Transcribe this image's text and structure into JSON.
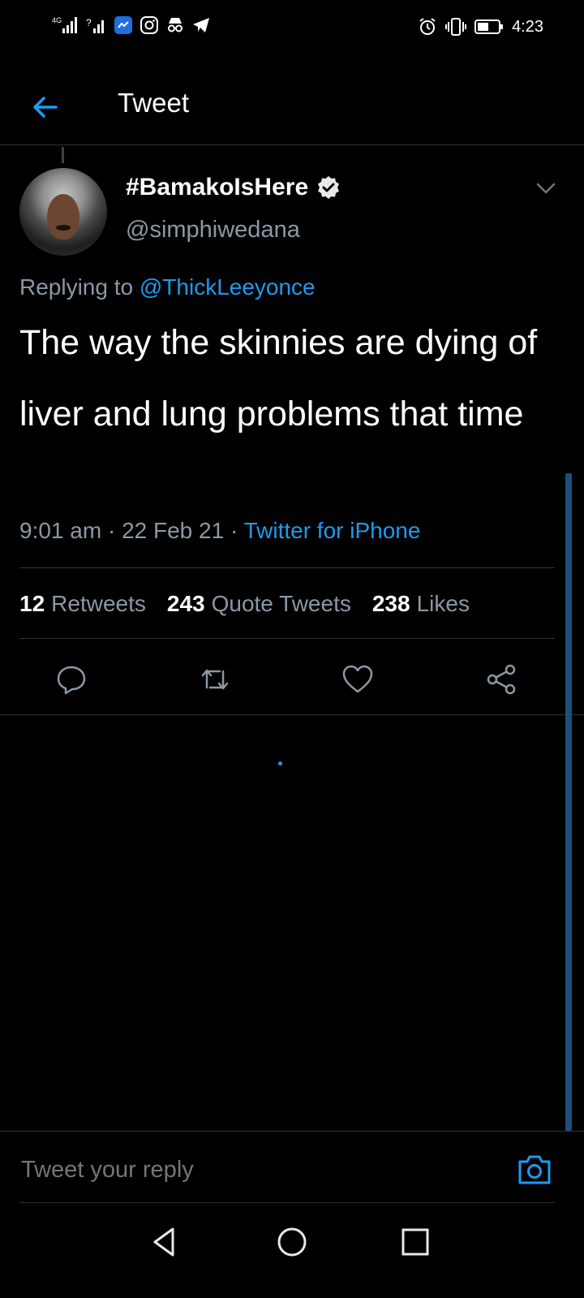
{
  "status_bar": {
    "network": "4G",
    "time": "4:23",
    "icons": [
      "signal-icon",
      "wifi-icon",
      "messenger-icon",
      "instagram-icon",
      "incognito-icon",
      "telegram-icon",
      "alarm-icon",
      "vibrate-icon",
      "battery-icon"
    ]
  },
  "header": {
    "title": "Tweet",
    "back_icon": "arrow-left-icon"
  },
  "tweet": {
    "author_name": "#BamakoIsHere",
    "author_handle": "@simphiwedana",
    "verified": true,
    "replying_prefix": "Replying to",
    "replying_to": "@ThickLeeyonce",
    "text": "The way the skinnies are dying of liver and lung problems that time",
    "time": "9:01 am",
    "date": "22 Feb 21",
    "source": "Twitter for iPhone",
    "sep": "·"
  },
  "stats": {
    "retweets_count": "12",
    "retweets_label": "Retweets",
    "quotes_count": "243",
    "quotes_label": "Quote Tweets",
    "likes_count": "238",
    "likes_label": "Likes"
  },
  "actions": [
    "reply-icon",
    "retweet-icon",
    "like-icon",
    "share-icon"
  ],
  "reply_bar": {
    "placeholder": "Tweet your reply",
    "camera_icon": "camera-icon"
  },
  "colors": {
    "accent": "#1d9bf0",
    "muted": "#8b98a5",
    "background": "#000000",
    "divider": "#2f3336"
  }
}
